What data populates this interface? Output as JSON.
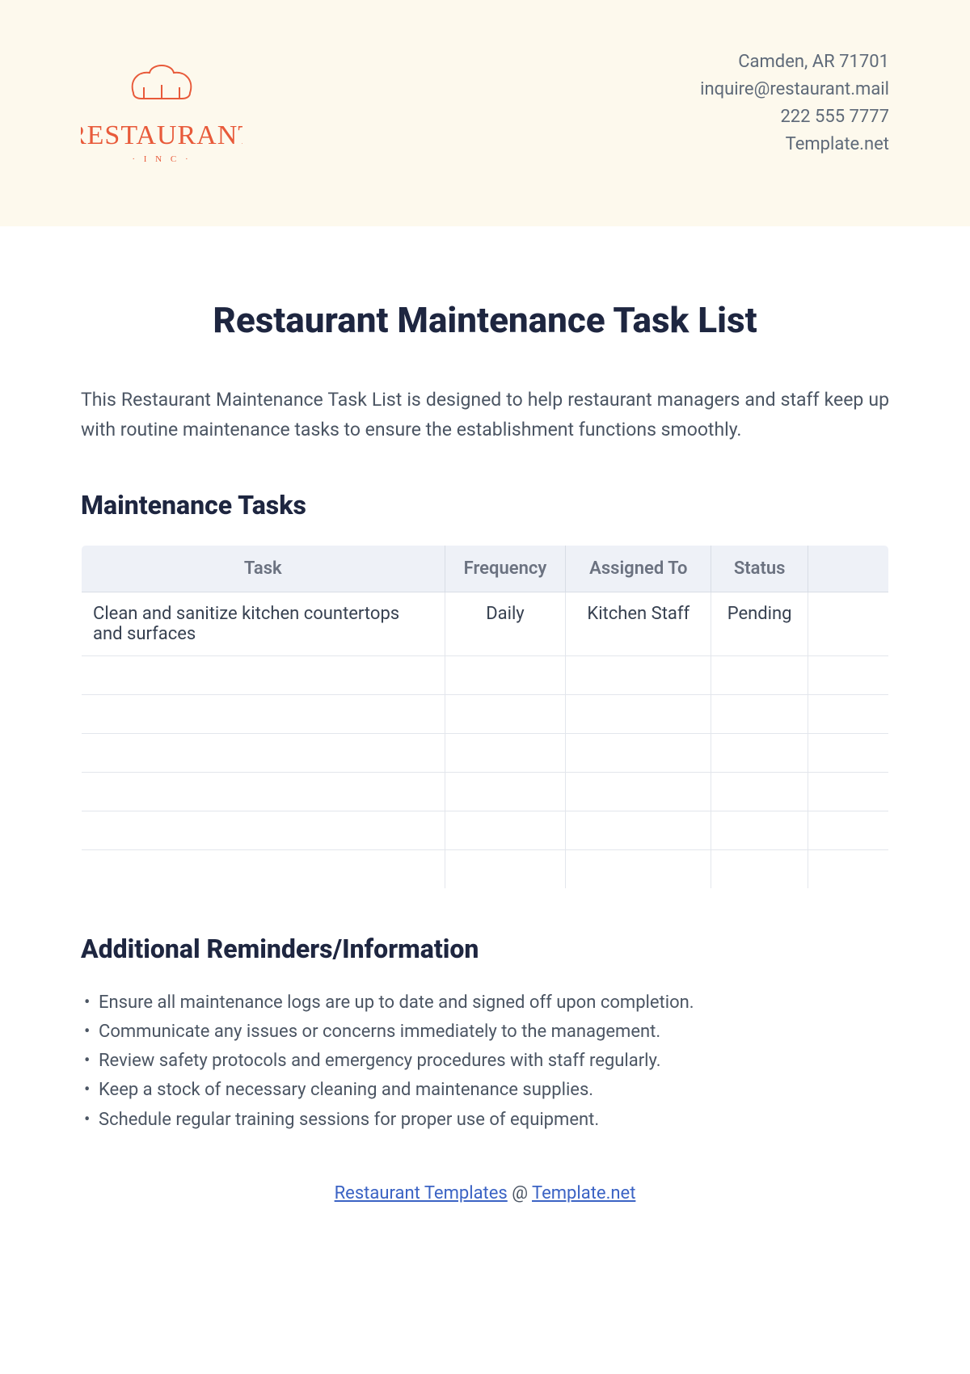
{
  "header": {
    "logo": {
      "main_text": "RESTAURANT",
      "sub_text": "· I N C ·"
    },
    "contact": {
      "address": "Camden, AR 71701",
      "email": "inquire@restaurant.mail",
      "phone": "222 555 7777",
      "site": "Template.net"
    }
  },
  "title": "Restaurant Maintenance Task List",
  "intro": "This Restaurant Maintenance Task List is designed to help restaurant managers and staff keep up with routine maintenance tasks to ensure the establishment functions smoothly.",
  "sections": {
    "tasks_heading": "Maintenance Tasks",
    "reminders_heading": "Additional Reminders/Information"
  },
  "table": {
    "headers": {
      "task": "Task",
      "frequency": "Frequency",
      "assigned": "Assigned To",
      "status": "Status"
    },
    "rows": [
      {
        "task": "Clean and sanitize kitchen countertops and surfaces",
        "frequency": "Daily",
        "assigned": "Kitchen Staff",
        "status": "Pending"
      },
      {
        "task": "",
        "frequency": "",
        "assigned": "",
        "status": ""
      },
      {
        "task": "",
        "frequency": "",
        "assigned": "",
        "status": ""
      },
      {
        "task": "",
        "frequency": "",
        "assigned": "",
        "status": ""
      },
      {
        "task": "",
        "frequency": "",
        "assigned": "",
        "status": ""
      },
      {
        "task": "",
        "frequency": "",
        "assigned": "",
        "status": ""
      },
      {
        "task": "",
        "frequency": "",
        "assigned": "",
        "status": ""
      }
    ]
  },
  "reminders": [
    "Ensure all maintenance logs are up to date and signed off upon completion.",
    "Communicate any issues or concerns immediately to the management.",
    "Review safety protocols and emergency procedures with staff regularly.",
    "Keep a stock of necessary cleaning and maintenance supplies.",
    "Schedule regular training sessions for proper use of equipment."
  ],
  "footer": {
    "link1": "Restaurant Templates",
    "at": " @ ",
    "link2": "Template.net"
  }
}
